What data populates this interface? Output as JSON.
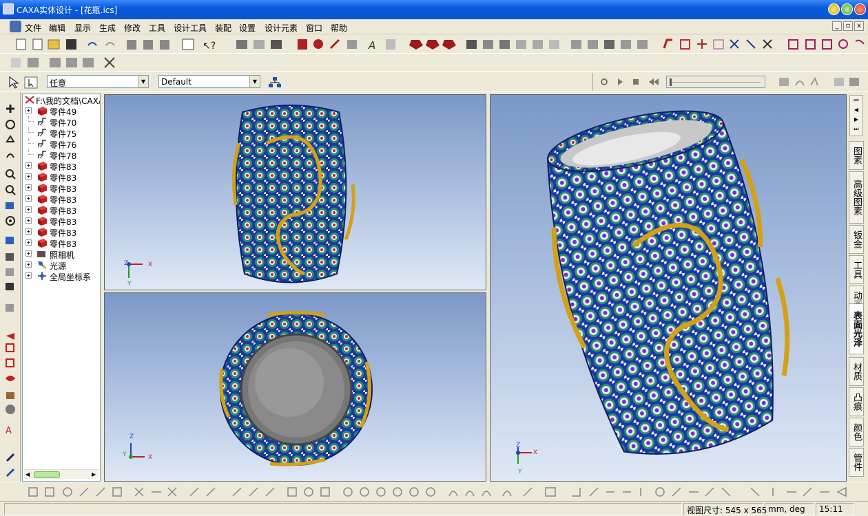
{
  "window": {
    "title": "CAXA实体设计 - [花瓶.ics]"
  },
  "menu": {
    "items": [
      "文件",
      "编辑",
      "显示",
      "生成",
      "修改",
      "工具",
      "设计工具",
      "装配",
      "设置",
      "设计元素",
      "窗口",
      "帮助"
    ]
  },
  "toolbar": {
    "filter_select": "任意",
    "style_select": "Default"
  },
  "tree": {
    "root": "F:\\我的文档\\CAXA",
    "items": [
      {
        "label": "零件49",
        "expand": true,
        "icon": "part-icon"
      },
      {
        "label": "零件70",
        "expand": false,
        "icon": "curve-icon"
      },
      {
        "label": "零件75",
        "expand": false,
        "icon": "curve-icon"
      },
      {
        "label": "零件76",
        "expand": false,
        "icon": "curve-icon"
      },
      {
        "label": "零件78",
        "expand": false,
        "icon": "curve-icon"
      },
      {
        "label": "零件83",
        "expand": true,
        "icon": "part-icon"
      },
      {
        "label": "零件83",
        "expand": true,
        "icon": "part-icon"
      },
      {
        "label": "零件83",
        "expand": true,
        "icon": "part-icon"
      },
      {
        "label": "零件83",
        "expand": true,
        "icon": "part-icon"
      },
      {
        "label": "零件83",
        "expand": true,
        "icon": "part-icon"
      },
      {
        "label": "零件83",
        "expand": true,
        "icon": "part-icon"
      },
      {
        "label": "零件83",
        "expand": true,
        "icon": "part-icon"
      },
      {
        "label": "零件83",
        "expand": true,
        "icon": "part-icon"
      },
      {
        "label": "照相机",
        "expand": true,
        "icon": "camera-icon"
      },
      {
        "label": "光源",
        "expand": true,
        "icon": "light-icon"
      },
      {
        "label": "全局坐标系",
        "expand": true,
        "icon": "axes-icon"
      }
    ]
  },
  "axes": {
    "x": "X",
    "y": "Y",
    "z": "Z"
  },
  "right_tabs": [
    "图素",
    "高级图素",
    "钣金",
    "工具",
    "动画",
    "表面光泽",
    "材质",
    "凸痕",
    "颜色",
    "管件"
  ],
  "status": {
    "view_size_label": "视图尺寸:",
    "view_size": "545 x 565",
    "units": "mm, deg",
    "time": "15:11"
  },
  "colors": {
    "titlebar": "#0a5ce0",
    "viewport_top": "#7a98c8",
    "vase_body": "#1b3a9e",
    "vase_trim": "#d4a017"
  }
}
